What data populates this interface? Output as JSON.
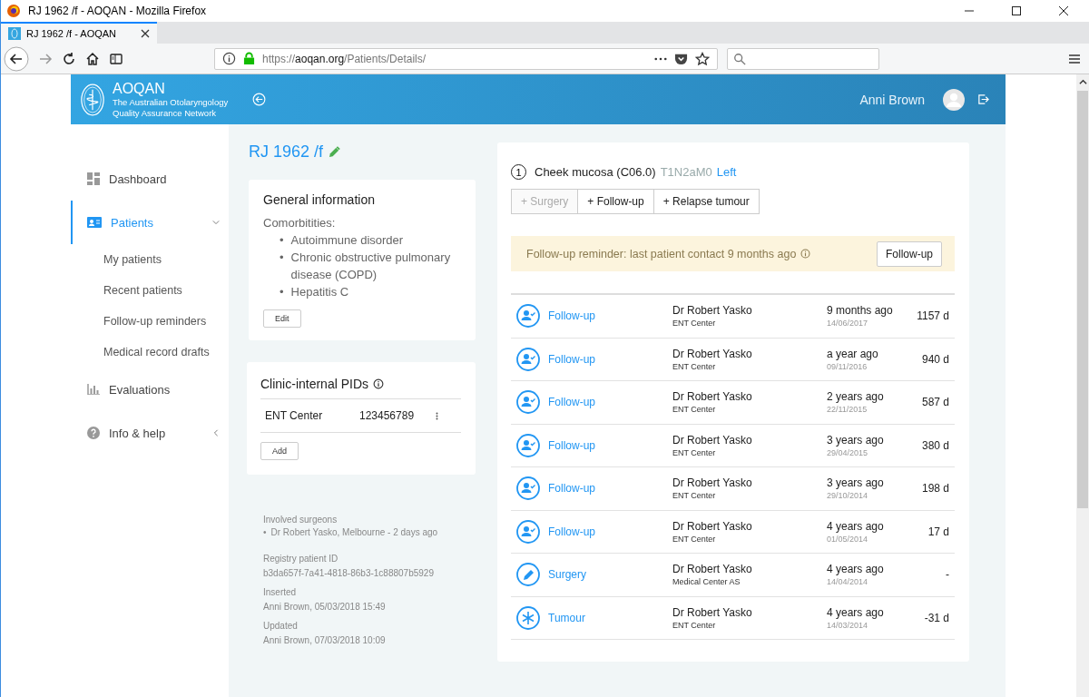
{
  "window": {
    "title": "RJ 1962 /f - AOQAN - Mozilla Firefox"
  },
  "browser": {
    "tabs": [
      {
        "title": "RJ 1962 /f - AOQAN",
        "selected": true
      }
    ],
    "url": {
      "scheme": "https://",
      "domain": "aoqan.org",
      "path": "/Patients/Details/"
    }
  },
  "header": {
    "app_name": "AOQAN",
    "subtitle": "The Australian Otolaryngology Quality Assurance Network",
    "user": "Anni Brown"
  },
  "sidebar": {
    "items": [
      {
        "label": "Dashboard",
        "selected": false
      },
      {
        "label": "Patients",
        "selected": true,
        "expanded": true,
        "children": [
          {
            "label": "My patients",
            "selected": false
          },
          {
            "label": "Recent patients",
            "selected": false
          },
          {
            "label": "Follow-up reminders",
            "selected": false
          },
          {
            "label": "Medical record drafts",
            "selected": false
          }
        ]
      },
      {
        "label": "Evaluations",
        "selected": false
      },
      {
        "label": "Info & help",
        "selected": false,
        "expanded": false
      }
    ]
  },
  "patient": {
    "title": "RJ 1962 /f",
    "general_info": {
      "title": "General information",
      "comorbidities_label": "Comorbitities:",
      "bullet": "•",
      "comorbidities": [
        "Autoimmune disorder",
        "Chronic obstructive pulmonary disease (COPD)",
        "Hepatitis C"
      ],
      "edit_button": "Edit"
    },
    "pids": {
      "title": "Clinic-internal PIDs",
      "rows": [
        {
          "clinic": "ENT Center",
          "pid": "123456789"
        }
      ],
      "add_button": "Add"
    },
    "meta": {
      "surgeons_label": "Involved surgeons",
      "bullet": "•",
      "surgeons": [
        "Dr Robert Yasko, Melbourne - 2 days ago"
      ],
      "fields": [
        {
          "label": "Registry patient ID",
          "value": "b3da657f-7a41-4818-86b3-1c88807b5929"
        },
        {
          "label": "Inserted",
          "value": "Anni Brown, 05/03/2018 15:49"
        },
        {
          "label": "Updated",
          "value": "Anni Brown, 07/03/2018 10:09"
        }
      ]
    }
  },
  "tumour": {
    "number": "1",
    "site": "Cheek mucosa (C06.0)",
    "stage": "T1N2aM0",
    "side": "Left",
    "actions": [
      {
        "label": "+ Surgery",
        "disabled": true
      },
      {
        "label": "+ Follow-up",
        "disabled": false
      },
      {
        "label": "+ Relapse tumour",
        "disabled": false
      }
    ],
    "reminder": {
      "text": "Follow-up reminder: last patient contact 9 months ago",
      "button": "Follow-up"
    },
    "events": [
      {
        "kind": "follow-up",
        "label": "Follow-up",
        "surgeon": "Dr Robert Yasko",
        "center": "ENT Center",
        "when": "9 months ago",
        "date": "14/06/2017",
        "days": "1157 d"
      },
      {
        "kind": "follow-up",
        "label": "Follow-up",
        "surgeon": "Dr Robert Yasko",
        "center": "ENT Center",
        "when": "a year ago",
        "date": "09/11/2016",
        "days": "940 d"
      },
      {
        "kind": "follow-up",
        "label": "Follow-up",
        "surgeon": "Dr Robert Yasko",
        "center": "ENT Center",
        "when": "2 years ago",
        "date": "22/11/2015",
        "days": "587 d"
      },
      {
        "kind": "follow-up",
        "label": "Follow-up",
        "surgeon": "Dr Robert Yasko",
        "center": "ENT Center",
        "when": "3 years ago",
        "date": "29/04/2015",
        "days": "380 d"
      },
      {
        "kind": "follow-up",
        "label": "Follow-up",
        "surgeon": "Dr Robert Yasko",
        "center": "ENT Center",
        "when": "3 years ago",
        "date": "29/10/2014",
        "days": "198 d"
      },
      {
        "kind": "follow-up",
        "label": "Follow-up",
        "surgeon": "Dr Robert Yasko",
        "center": "ENT Center",
        "when": "4 years ago",
        "date": "01/05/2014",
        "days": "17 d"
      },
      {
        "kind": "surgery",
        "label": "Surgery",
        "surgeon": "Dr Robert Yasko",
        "center": "Medical Center AS",
        "when": "4 years ago",
        "date": "14/04/2014",
        "days": "-"
      },
      {
        "kind": "tumour",
        "label": "Tumour",
        "surgeon": "Dr Robert Yasko",
        "center": "ENT Center",
        "when": "4 years ago",
        "date": "14/03/2014",
        "days": "-31 d"
      }
    ]
  }
}
